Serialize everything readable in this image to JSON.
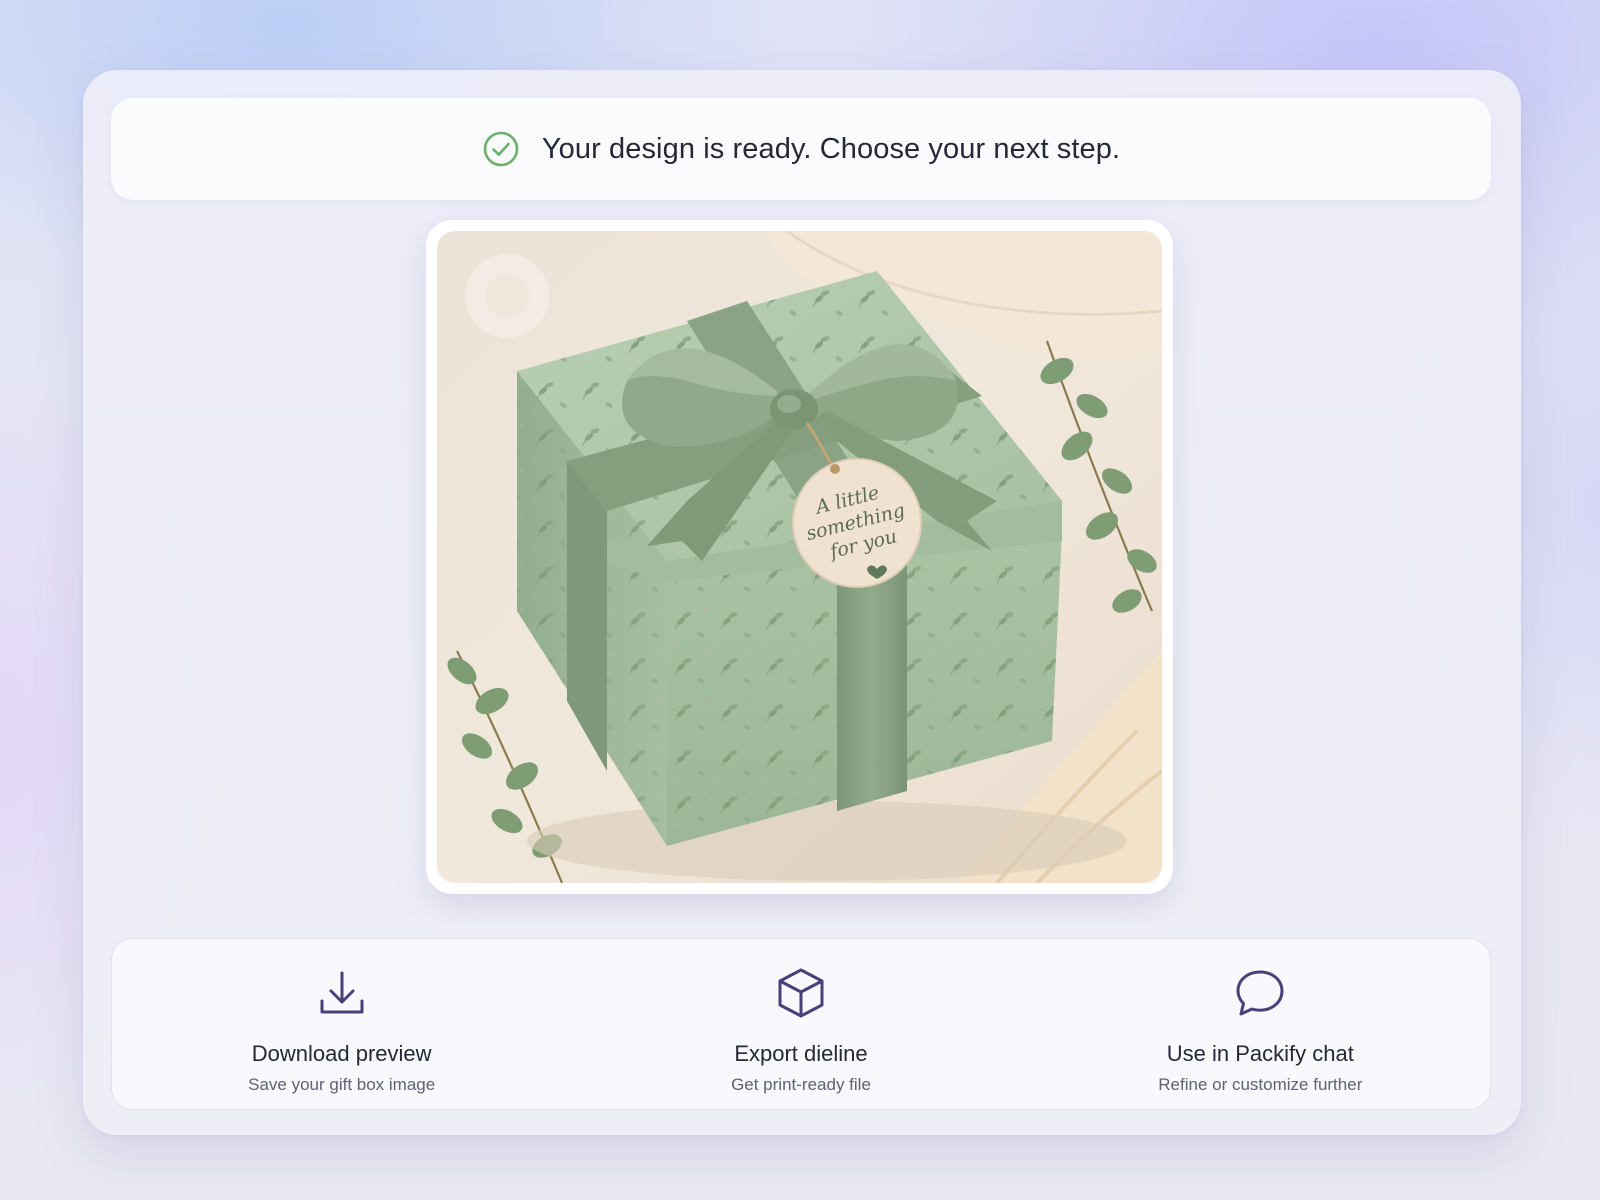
{
  "status": {
    "icon": "check-circle-icon",
    "message": "Your design is ready. Choose your next step.",
    "icon_color": "#6bb06a"
  },
  "preview": {
    "tag_lines": [
      "A little",
      "something",
      "for you"
    ],
    "colors": {
      "box": "#a9c4a4",
      "ribbon": "#87a07f",
      "background": "#efe5d8",
      "tag": "#efe2d0"
    }
  },
  "actions": [
    {
      "icon": "download-icon",
      "title": "Download preview",
      "subtitle": "Save your gift box image"
    },
    {
      "icon": "box-3d-icon",
      "title": "Export dieline",
      "subtitle": "Get print-ready file"
    },
    {
      "icon": "chat-bubble-icon",
      "title": "Use in Packify chat",
      "subtitle": "Refine or customize further"
    }
  ],
  "accent_color": "#4a3f7a"
}
